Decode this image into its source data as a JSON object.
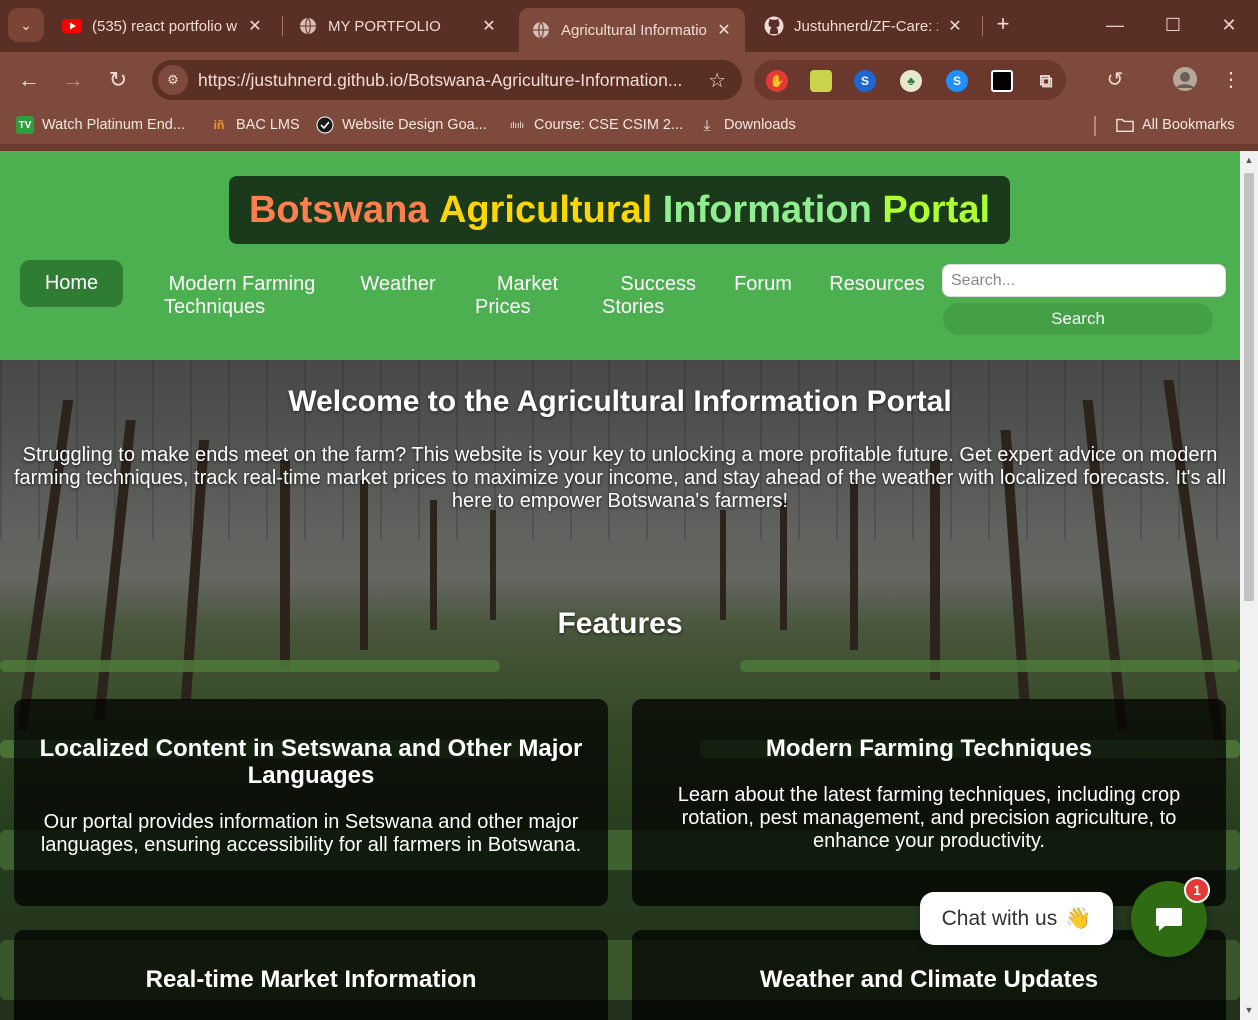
{
  "browser": {
    "tabs": [
      {
        "title": "(535) react portfolio w",
        "icon": "youtube-icon"
      },
      {
        "title": "MY PORTFOLIO",
        "icon": "globe-icon"
      },
      {
        "title": "Agricultural Informatio",
        "icon": "globe-icon",
        "active": true
      },
      {
        "title": "Justuhnerd/ZF-Care: z",
        "icon": "github-icon"
      }
    ],
    "url": "https://justuhnerd.github.io/Botswana-Agriculture-Information...",
    "bookmarks": [
      {
        "label": "Watch Platinum End...",
        "icon": "tv-icon"
      },
      {
        "label": "BAC LMS",
        "icon": "bac-icon"
      },
      {
        "label": "Website Design Goa...",
        "icon": "globe-icon"
      },
      {
        "label": "Course: CSE CSIM 2...",
        "icon": "cisco-icon"
      },
      {
        "label": "Downloads",
        "icon": "download-icon"
      }
    ],
    "all_bookmarks": "All Bookmarks"
  },
  "site": {
    "title_parts": [
      "Botswana ",
      "Agricultural ",
      "Information ",
      "Portal"
    ],
    "title_colors": [
      "#ff7f50",
      "#ffd700",
      "#90ee90",
      "#adff2f"
    ],
    "nav": {
      "home": "Home",
      "modern_1": "Modern Farming",
      "modern_2": "Techniques",
      "weather": "Weather",
      "market_1": "Market",
      "market_2": "Prices",
      "success_1": "Success",
      "success_2": "Stories",
      "forum": "Forum",
      "resources": "Resources"
    },
    "search": {
      "placeholder": "Search...",
      "button": "Search"
    },
    "welcome": "Welcome to the Agricultural Information Portal",
    "intro": "Struggling to make ends meet on the farm? This website is your key to unlocking a more profitable future. Get expert advice on modern farming techniques, track real-time market prices to maximize your income, and stay ahead of the weather with localized forecasts. It's all here to empower Botswana's farmers!",
    "features_heading": "Features",
    "features": [
      {
        "title": "Localized Content in Setswana and Other Major Languages",
        "text": "Our portal provides information in Setswana and other major languages, ensuring accessibility for all farmers in Botswana."
      },
      {
        "title": "Modern Farming Techniques",
        "text": "Learn about the latest farming techniques, including crop rotation, pest management, and precision agriculture, to enhance your productivity."
      },
      {
        "title": "Real-time Market Information",
        "text": ""
      },
      {
        "title": "Weather and Climate Updates",
        "text": ""
      }
    ],
    "chat": {
      "label": "Chat with us",
      "emoji": "👋",
      "badge": "1"
    }
  }
}
